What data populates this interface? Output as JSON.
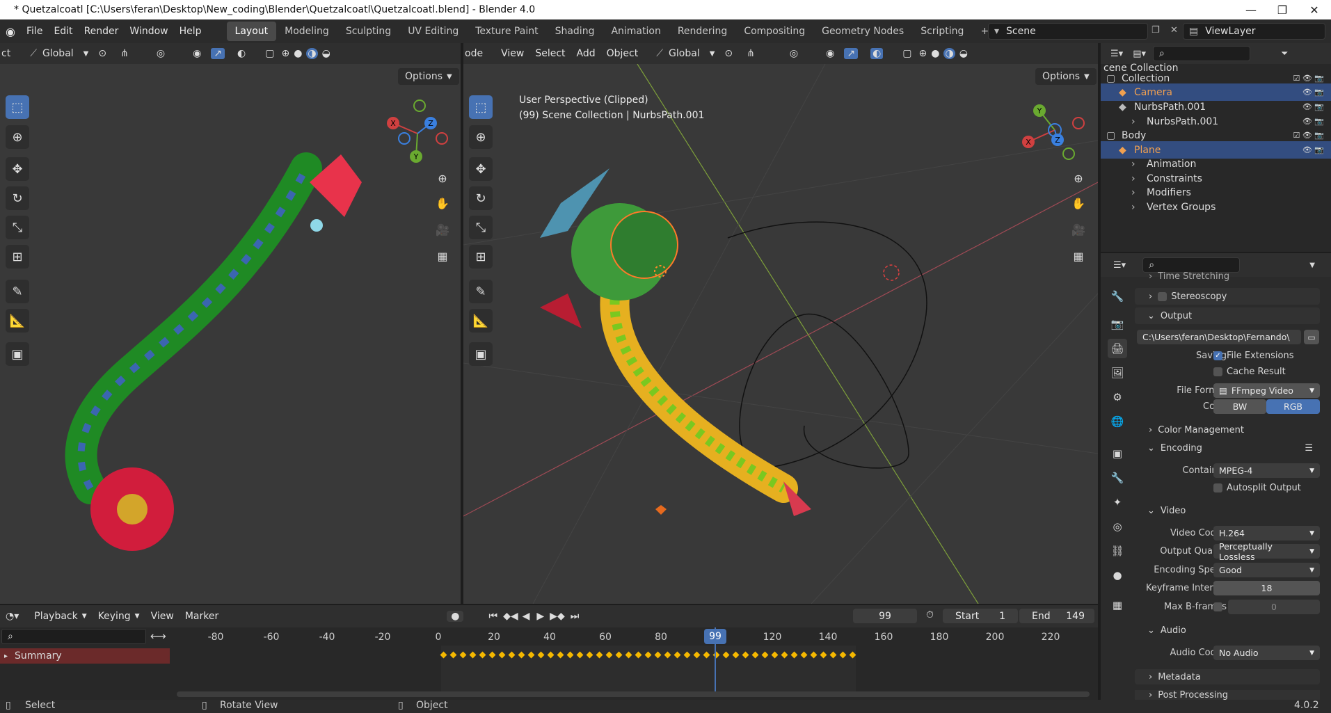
{
  "window": {
    "title": "* Quetzalcoatl [C:\\Users\\feran\\Desktop\\New_coding\\Blender\\Quetzalcoatl\\Quetzalcoatl.blend] - Blender 4.0",
    "minimize": "—",
    "restore": "❐",
    "close": "✕"
  },
  "menubar": {
    "items": [
      "File",
      "Edit",
      "Render",
      "Window",
      "Help"
    ]
  },
  "workspaces": [
    "Layout",
    "Modeling",
    "Sculpting",
    "UV Editing",
    "Texture Paint",
    "Shading",
    "Animation",
    "Rendering",
    "Compositing",
    "Geometry Nodes",
    "Scripting"
  ],
  "add_workspace": "+",
  "scene": {
    "name": "Scene",
    "viewlayer": "ViewLayer"
  },
  "viewport_left": {
    "mode_fragment": "ct",
    "orientation": "Global",
    "options": "Options",
    "gizmo": {
      "x": "X",
      "y": "Y",
      "z": "Z"
    }
  },
  "viewport_right": {
    "mode_fragment": "ode",
    "menus": [
      "View",
      "Select",
      "Add",
      "Object"
    ],
    "orientation": "Global",
    "options": "Options",
    "info_line1": "User Perspective (Clipped)",
    "info_line2": "(99) Scene Collection | NurbsPath.001",
    "gizmo": {
      "x": "X",
      "y": "Y",
      "z": "Z"
    }
  },
  "outliner": {
    "header": "cene Collection",
    "rows": [
      {
        "label": "Collection",
        "indent": 0,
        "highlight": false,
        "color": "#dcdcdc"
      },
      {
        "label": "Camera",
        "indent": 1,
        "highlight": true,
        "color": "#f0a050"
      },
      {
        "label": "NurbsPath.001",
        "indent": 1,
        "highlight": false,
        "color": "#dcdcdc"
      },
      {
        "label": "NurbsPath.001",
        "indent": 2,
        "highlight": false,
        "color": "#dcdcdc"
      },
      {
        "label": "Body",
        "indent": 0,
        "highlight": false,
        "color": "#dcdcdc"
      },
      {
        "label": "Plane",
        "indent": 1,
        "highlight": true,
        "color": "#f0a050"
      },
      {
        "label": "Animation",
        "indent": 2,
        "highlight": false,
        "color": "#dcdcdc"
      },
      {
        "label": "Constraints",
        "indent": 2,
        "highlight": false,
        "color": "#dcdcdc"
      },
      {
        "label": "Modifiers",
        "indent": 2,
        "highlight": false,
        "color": "#dcdcdc"
      },
      {
        "label": "Vertex Groups",
        "indent": 2,
        "highlight": false,
        "color": "#dcdcdc"
      }
    ]
  },
  "properties": {
    "time_stretching": "Time Stretching",
    "stereoscopy": "Stereoscopy",
    "output": "Output",
    "path": "C:\\Users\\feran\\Desktop\\Fernando\\",
    "saving_label": "Saving",
    "file_extensions": "File Extensions",
    "cache_result": "Cache Result",
    "file_format_label": "File Format",
    "file_format": "FFmpeg Video",
    "color_label": "Color",
    "color_bw": "BW",
    "color_rgb": "RGB",
    "color_management": "Color Management",
    "encoding": "Encoding",
    "container_label": "Container",
    "container": "MPEG-4",
    "autosplit": "Autosplit Output",
    "video": "Video",
    "video_codec_label": "Video Codec",
    "video_codec": "H.264",
    "output_quality_label": "Output Quality",
    "output_quality": "Perceptually Lossless",
    "encoding_speed_label": "Encoding Speed",
    "encoding_speed": "Good",
    "keyframe_interval_label": "Keyframe Interval",
    "keyframe_interval": "18",
    "max_bframes_label": "Max B-frames",
    "max_bframes": "0",
    "audio": "Audio",
    "audio_codec_label": "Audio Codec",
    "audio_codec": "No Audio",
    "metadata": "Metadata",
    "post_processing": "Post Processing"
  },
  "timeline": {
    "menus": [
      "Playback",
      "Keying",
      "View",
      "Marker"
    ],
    "current_frame": "99",
    "start_label": "Start",
    "start": "1",
    "end_label": "End",
    "end": "149",
    "summary": "Summary",
    "ticks": [
      "-80",
      "-60",
      "-40",
      "-20",
      "0",
      "20",
      "40",
      "60",
      "80",
      "99",
      "120",
      "140",
      "160",
      "180",
      "200",
      "220"
    ]
  },
  "statusbar": {
    "select": "Select",
    "rotate": "Rotate View",
    "object": "Object",
    "version": "4.0.2"
  },
  "colors": {
    "accent": "#4772b3",
    "active_object": "#f0a050",
    "keyframe": "#f5b800"
  }
}
